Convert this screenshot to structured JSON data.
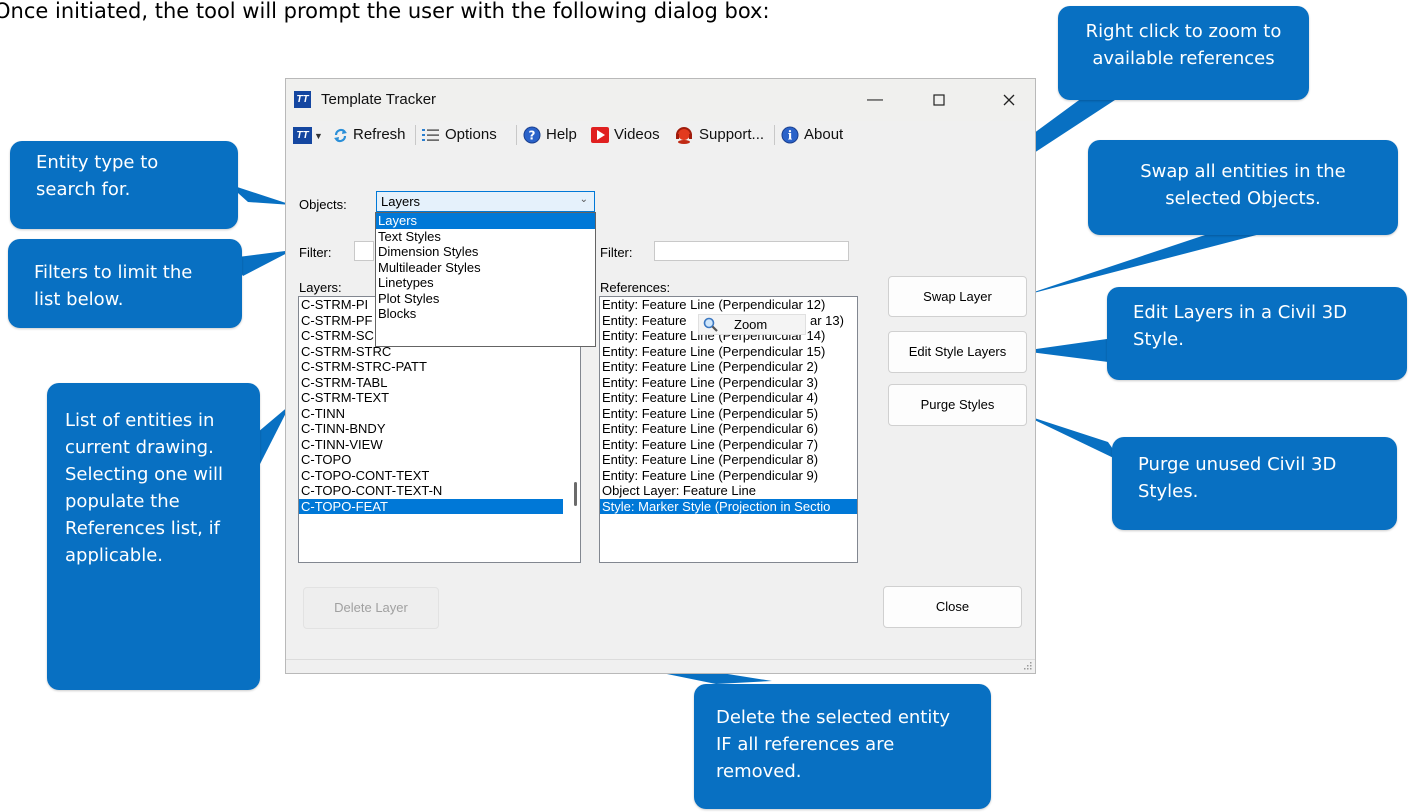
{
  "intro_text": "Once initiated, the tool will prompt the user with the following dialog box:",
  "window": {
    "title": "Template Tracker",
    "toolbar": {
      "refresh": "Refresh",
      "options": "Options",
      "help": "Help",
      "videos": "Videos",
      "support": "Support...",
      "about": "About"
    },
    "objects_label": "Objects:",
    "objects_value": "Layers",
    "objects_options": [
      "Layers",
      "Text Styles",
      "Dimension Styles",
      "Multileader Styles",
      "Linetypes",
      "Plot Styles",
      "Blocks"
    ],
    "filter_label": "Filter:",
    "ref_filter_label": "Filter:",
    "layers_label": "Layers:",
    "references_label": "References:",
    "layers": [
      "C-STRM-PIPE",
      "C-STRM-PROF",
      "C-STRM-SCTN",
      "C-STRM-STRC",
      "C-STRM-STRC-PATT",
      "C-STRM-TABL",
      "C-STRM-TEXT",
      "C-TINN",
      "C-TINN-BNDY",
      "C-TINN-VIEW",
      "C-TOPO",
      "C-TOPO-CONT-TEXT",
      "C-TOPO-CONT-TEXT-N",
      "C-TOPO-FEAT"
    ],
    "layers_visible": [
      "C-STRM-PI",
      "C-STRM-PF",
      "C-STRM-SC",
      "C-STRM-STRC",
      "C-STRM-STRC-PATT",
      "C-STRM-TABL",
      "C-STRM-TEXT",
      "C-TINN",
      "C-TINN-BNDY",
      "C-TINN-VIEW",
      "C-TOPO",
      "C-TOPO-CONT-TEXT",
      "C-TOPO-CONT-TEXT-N",
      "C-TOPO-FEAT"
    ],
    "layers_selected": "C-TOPO-FEAT",
    "references": [
      "Entity: Feature Line (Perpendicular 12)",
      "Entity: Feature",
      "Entity: Feature Line (Perpendicular 14)",
      "Entity: Feature Line (Perpendicular 15)",
      "Entity: Feature Line (Perpendicular 2)",
      "Entity: Feature Line (Perpendicular 3)",
      "Entity: Feature Line (Perpendicular 4)",
      "Entity: Feature Line (Perpendicular 5)",
      "Entity: Feature Line (Perpendicular 6)",
      "Entity: Feature Line (Perpendicular 7)",
      "Entity: Feature Line (Perpendicular 8)",
      "Entity: Feature Line (Perpendicular 9)",
      "Object Layer: Feature Line",
      "Style: Marker Style (Projection in Sectio"
    ],
    "references_selected": "Style: Marker Style (Projection in Sectio",
    "ref_row2_suffix": "ar 13)",
    "context_menu": {
      "label": "Zoom"
    },
    "buttons": {
      "swap": "Swap Layer",
      "edit_style": "Edit Style Layers",
      "purge": "Purge Styles",
      "delete": "Delete Layer",
      "close": "Close"
    }
  },
  "callouts": {
    "entity_type": "Entity type to search for.",
    "filters": "Filters to limit the list below.",
    "list_entities": "List of entities in current drawing. Selecting one will populate the References list, if applicable.",
    "zoom": "Right click to zoom to available references",
    "swap": "Swap all entities in the selected Objects.",
    "edit": "Edit Layers in a Civil 3D Style.",
    "purge": "Purge unused Civil 3D Styles.",
    "delete": "Delete the selected entity IF all references are removed."
  },
  "colors": {
    "callout": "#0870c2",
    "selection": "#0078d7",
    "window_bg": "#f0f0f0"
  }
}
